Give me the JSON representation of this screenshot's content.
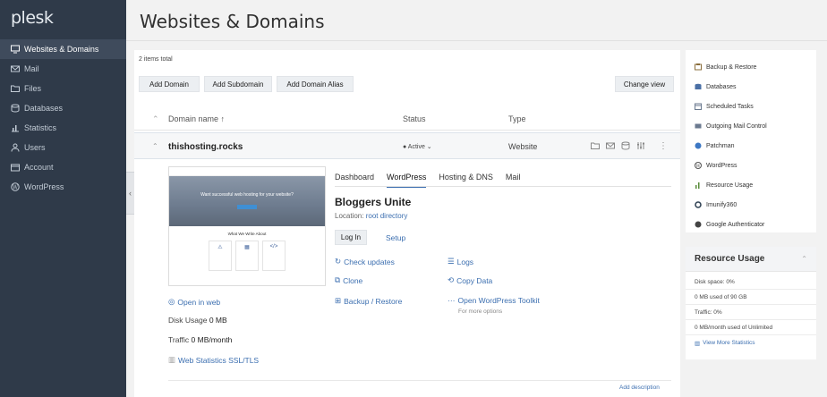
{
  "app": {
    "logo": "plesk"
  },
  "sidebar": {
    "items": [
      {
        "label": "Websites & Domains",
        "icon": "monitor-icon",
        "active": true
      },
      {
        "label": "Mail",
        "icon": "mail-icon"
      },
      {
        "label": "Files",
        "icon": "folder-icon"
      },
      {
        "label": "Databases",
        "icon": "database-icon"
      },
      {
        "label": "Statistics",
        "icon": "bar-chart-icon"
      },
      {
        "label": "Users",
        "icon": "user-icon"
      },
      {
        "label": "Account",
        "icon": "account-icon"
      },
      {
        "label": "WordPress",
        "icon": "wordpress-icon"
      }
    ],
    "collapse_glyph": "‹"
  },
  "header": {
    "title": "Websites & Domains"
  },
  "main": {
    "items_total": "2 items total",
    "buttons": {
      "add_domain": "Add Domain",
      "add_subdomain": "Add Subdomain",
      "add_alias": "Add Domain Alias",
      "change_view": "Change view"
    },
    "columns": {
      "name": "Domain name ↑",
      "status": "Status",
      "type": "Type"
    },
    "domain": {
      "name": "thishosting.rocks",
      "status": "● Active ⌄",
      "type": "Website",
      "tabs": [
        "Dashboard",
        "WordPress",
        "Hosting & DNS",
        "Mail"
      ],
      "active_tab": "WordPress",
      "site_title": "Bloggers Unite",
      "location_label": "Location:",
      "location_value": "root directory",
      "login": "Log In",
      "setup": "Setup",
      "actions": {
        "check_updates": "Check updates",
        "logs": "Logs",
        "clone": "Clone",
        "copy_data": "Copy Data",
        "backup": "Backup / Restore",
        "open_toolkit": "Open WordPress Toolkit",
        "more_options": "For more options"
      },
      "open_in_web": "Open in web",
      "disk_usage_label": "Disk Usage",
      "disk_usage_value": "0 MB",
      "traffic_label": "Traffic",
      "traffic_value": "0 MB/month",
      "web_stats": "Web Statistics SSL/TLS",
      "add_description": "Add description",
      "preview": {
        "hero_text": "Want successful web hosting for your website?",
        "sub_text": "What We Write About"
      }
    }
  },
  "right_panel": {
    "items": [
      {
        "label": "Backup & Restore",
        "icon": "backup-icon",
        "color": "#8a6d3b"
      },
      {
        "label": "Databases",
        "icon": "database-icon",
        "color": "#4a6fa5"
      },
      {
        "label": "Scheduled Tasks",
        "icon": "calendar-icon",
        "color": "#6b7a8f"
      },
      {
        "label": "Outgoing Mail Control",
        "icon": "mail-control-icon",
        "color": "#6b7a8f"
      },
      {
        "label": "Patchman",
        "icon": "patchman-icon",
        "color": "#3d78c4"
      },
      {
        "label": "WordPress",
        "icon": "wordpress-icon",
        "color": "#555555"
      },
      {
        "label": "Resource Usage",
        "icon": "resource-icon",
        "color": "#5a8d3b"
      },
      {
        "label": "Imunify360",
        "icon": "shield-icon",
        "color": "#2c3e50"
      },
      {
        "label": "Google Authenticator",
        "icon": "authenticator-icon",
        "color": "#444444"
      }
    ],
    "resource_usage": {
      "title": "Resource Usage",
      "disk_space": "Disk space: 0%",
      "disk_detail": "0 MB used of 90 GB",
      "traffic": "Traffic: 0%",
      "traffic_detail": "0 MB/month used of Unlimited",
      "view_more": "View More Statistics"
    }
  }
}
